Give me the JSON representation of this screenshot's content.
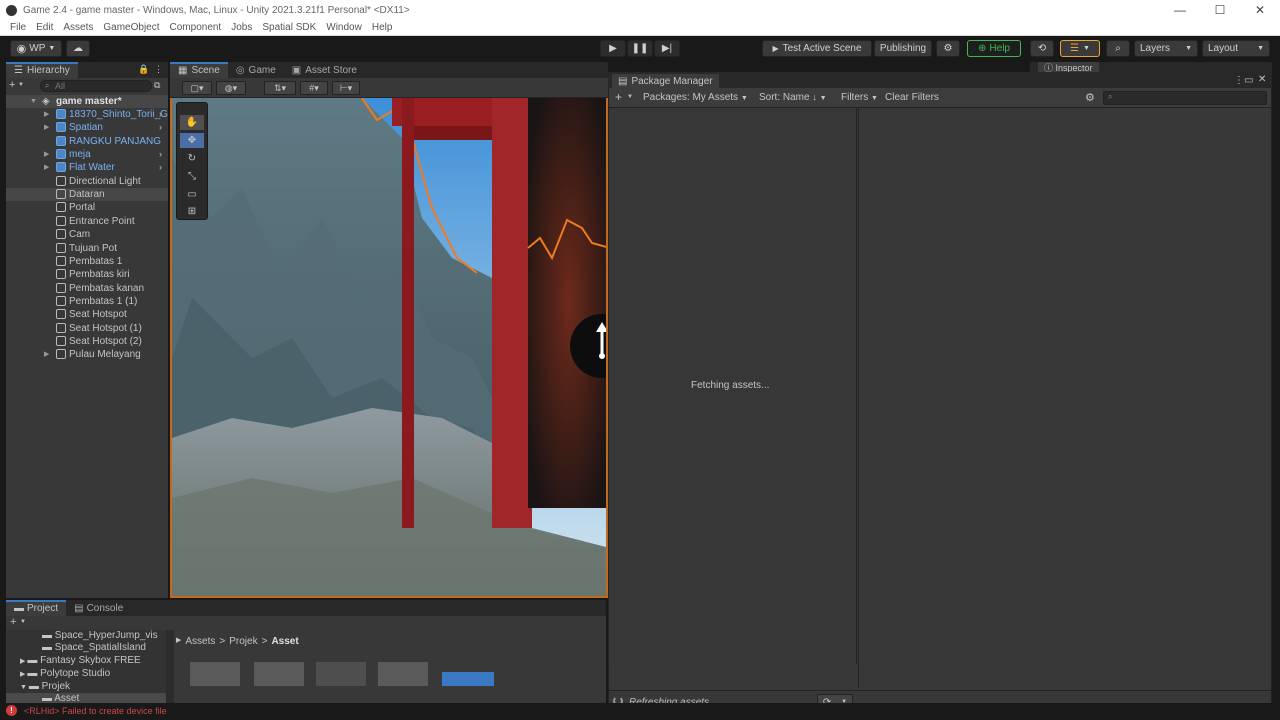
{
  "window": {
    "title": "Game 2.4 - game master - Windows, Mac, Linux - Unity 2021.3.21f1 Personal* <DX11>",
    "minimize": "—",
    "maximize": "☐",
    "close": "✕"
  },
  "menu": [
    "File",
    "Edit",
    "Assets",
    "GameObject",
    "Component",
    "Jobs",
    "Spatial SDK",
    "Window",
    "Help"
  ],
  "toolbar": {
    "account": "WP",
    "test_active_scene": "Test Active Scene",
    "publishing": "Publishing",
    "help": "Help",
    "layers": "Layers",
    "layout": "Layout"
  },
  "hierarchy": {
    "tab": "Hierarchy",
    "search_placeholder": "All",
    "scene_name": "game master*",
    "items": [
      {
        "label": "18370_Shinto_Torii_G",
        "prefab": true,
        "expand": true
      },
      {
        "label": "Spatian",
        "prefab": true,
        "expand": true
      },
      {
        "label": "RANGKU PANJANG",
        "prefab": true,
        "expand": false
      },
      {
        "label": "meja",
        "prefab": true,
        "expand": true
      },
      {
        "label": "Flat Water",
        "prefab": true,
        "expand": true
      },
      {
        "label": "Directional Light",
        "prefab": false,
        "expand": false
      },
      {
        "label": "Dataran",
        "prefab": false,
        "expand": false
      },
      {
        "label": "Portal",
        "prefab": false,
        "expand": false
      },
      {
        "label": "Entrance Point",
        "prefab": false,
        "expand": false
      },
      {
        "label": "Cam",
        "prefab": false,
        "expand": false
      },
      {
        "label": "Tujuan Pot",
        "prefab": false,
        "expand": false
      },
      {
        "label": "Pembatas 1",
        "prefab": false,
        "expand": false
      },
      {
        "label": "Pembatas kiri",
        "prefab": false,
        "expand": false
      },
      {
        "label": "Pembatas kanan",
        "prefab": false,
        "expand": false
      },
      {
        "label": "Pembatas 1 (1)",
        "prefab": false,
        "expand": false
      },
      {
        "label": "Seat Hotspot",
        "prefab": false,
        "expand": false
      },
      {
        "label": "Seat Hotspot (1)",
        "prefab": false,
        "expand": false
      },
      {
        "label": "Seat Hotspot (2)",
        "prefab": false,
        "expand": false
      },
      {
        "label": "Pulau Melayang",
        "prefab": false,
        "expand": true
      }
    ]
  },
  "scene": {
    "tabs": [
      "Scene",
      "Game",
      "Asset Store"
    ]
  },
  "inspector": {
    "tab": "Inspector"
  },
  "package_manager": {
    "title": "Package Manager",
    "packages_dropdown": "Packages: My Assets",
    "sort_dropdown": "Sort: Name",
    "filters_dropdown": "Filters",
    "clear_filters": "Clear Filters",
    "status": "Fetching assets...",
    "footer_status": "Refreshing assets..."
  },
  "project": {
    "tabs": [
      "Project",
      "Console"
    ],
    "tree": [
      "Space_HyperJump_vis",
      "Space_SpatialIsland",
      "Fantasy Skybox FREE",
      "Polytope Studio",
      "Projek",
      "Asset"
    ],
    "breadcrumb": [
      "Assets",
      "Projek",
      "Asset"
    ]
  },
  "statusbar": {
    "message": "<RLHid> Failed to create device file"
  }
}
